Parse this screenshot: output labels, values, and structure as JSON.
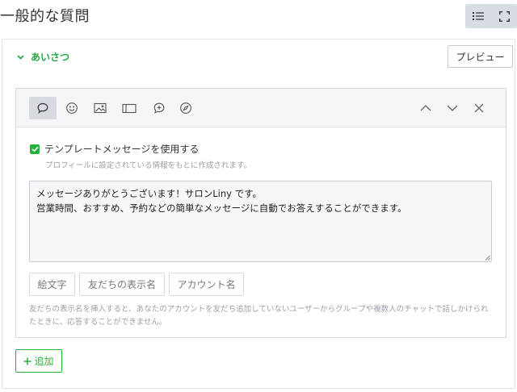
{
  "header": {
    "title": "一般的な質問",
    "actions": [
      {
        "icon": "list-view-icon"
      },
      {
        "icon": "fullscreen-icon"
      }
    ]
  },
  "section": {
    "title": "あいさつ",
    "expanded": true,
    "preview_label": "プレビュー"
  },
  "message_card": {
    "toolbar": {
      "tools": [
        {
          "icon": "speech-bubble-icon",
          "active": true
        },
        {
          "icon": "smiley-icon",
          "active": false
        },
        {
          "icon": "image-icon",
          "active": false
        },
        {
          "icon": "card-icon",
          "active": false
        },
        {
          "icon": "chat-plus-icon",
          "active": false
        },
        {
          "icon": "compass-icon",
          "active": false
        }
      ],
      "controls": [
        {
          "icon": "chevron-up-icon"
        },
        {
          "icon": "chevron-down-icon"
        },
        {
          "icon": "close-icon"
        }
      ]
    },
    "template_checkbox": {
      "checked": true,
      "label": "テンプレートメッセージを使用する",
      "help": "プロフィールに設定されている情報をもとに作成されます。"
    },
    "message_lines": [
      "メッセージありがとうございます！サロンLiny です。",
      "営業時間、おすすめ、予約などの簡単なメッセージに自動でお答えすることができます。"
    ],
    "insert_buttons": {
      "emoji": "絵文字",
      "friend_name": "友だちの表示名",
      "account_name": "アカウント名"
    },
    "insert_help": "友だちの表示名を挿入すると、あなたのアカウントを友だち追加していないユーザーからグループや複数人のチャットで話しかけられたときに、応答することができません。"
  },
  "add_button": {
    "label": "追加"
  },
  "colors": {
    "accent": "#21b33b",
    "toolbar_bg": "#f5f6f7",
    "active_tool_bg": "#d7dbe1",
    "message_bg": "#f6f7f9",
    "help_text": "#9aa0a6"
  }
}
